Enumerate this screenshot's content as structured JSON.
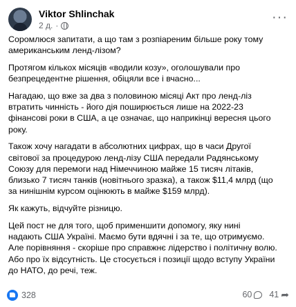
{
  "post": {
    "author": "Viktor Shlinchak",
    "time": "2 д.",
    "audience_icon": "globe-icon",
    "paragraphs": [
      "Соромлюся запитати, а що там з розпіареним більше року тому\nамериканським ленд-лізом?",
      "Протягом кількох місяців «водили козу», оголошували про\nбезпрецедентне рішення, обіцяли все і вчасно...",
      "Нагадаю, що вже за два з половиною місяці Акт про ленд-ліз\nвтратить чинність - його дія поширюється лише на 2022-23\nфінансові роки в США, а це означає, що наприкінці вересня цього\nроку.",
      "Також хочу нагадати в абсолютних цифрах, що в часи Другої\nсвітової за процедурою ленд-лізу США передали Радянському\nСоюзу для перемоги над Німеччиною майже 15 тисяч літаків,\nблизько 7 тисяч танків (новітнього зразка), а також $11,4 млрд (що\nза нинішнім курсом оцінюють  в майже $159 млрд).",
      "Як кажуть, відчуйте різницю.",
      "Цей пост не для того, щоб применшити  допомогу, яку нині\nнадають США Україні. Маємо бути вдячні і за те, що отримуємо.\nАле порівняння - скоріше про справжнє лідерство і політичну волю.\nАбо про їх відсутність. Це стосується і позиції щодо вступу України\nдо НАТО, до речі, теж."
    ]
  },
  "footer": {
    "likes": "328",
    "comments": "60",
    "shares": "41"
  }
}
